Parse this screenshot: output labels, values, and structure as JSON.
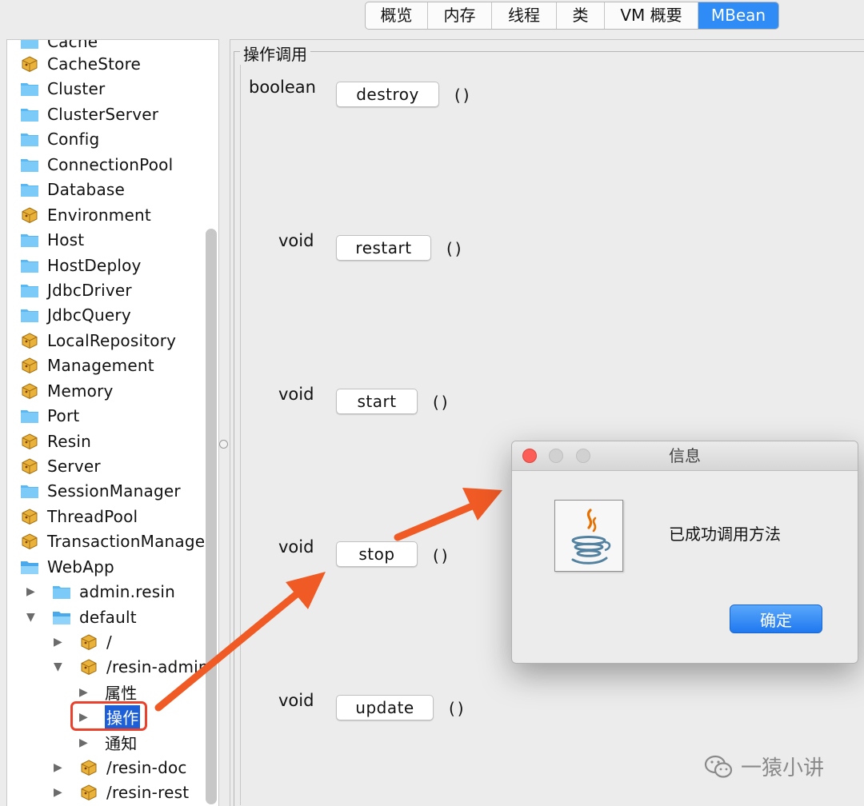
{
  "tabs": [
    {
      "label": "概览",
      "active": false
    },
    {
      "label": "内存",
      "active": false
    },
    {
      "label": "线程",
      "active": false
    },
    {
      "label": "类",
      "active": false
    },
    {
      "label": "VM 概要",
      "active": false
    },
    {
      "label": "MBean",
      "active": true
    }
  ],
  "tree": {
    "items": [
      {
        "label": "Cache",
        "icon": "folder-icon"
      },
      {
        "label": "CacheStore",
        "icon": "bean-icon"
      },
      {
        "label": "Cluster",
        "icon": "folder-icon"
      },
      {
        "label": "ClusterServer",
        "icon": "folder-icon"
      },
      {
        "label": "Config",
        "icon": "folder-icon"
      },
      {
        "label": "ConnectionPool",
        "icon": "folder-icon"
      },
      {
        "label": "Database",
        "icon": "folder-icon"
      },
      {
        "label": "Environment",
        "icon": "bean-icon"
      },
      {
        "label": "Host",
        "icon": "folder-icon"
      },
      {
        "label": "HostDeploy",
        "icon": "folder-icon"
      },
      {
        "label": "JdbcDriver",
        "icon": "folder-icon"
      },
      {
        "label": "JdbcQuery",
        "icon": "folder-icon"
      },
      {
        "label": "LocalRepository",
        "icon": "bean-icon"
      },
      {
        "label": "Management",
        "icon": "bean-icon"
      },
      {
        "label": "Memory",
        "icon": "bean-icon"
      },
      {
        "label": "Port",
        "icon": "folder-icon"
      },
      {
        "label": "Resin",
        "icon": "bean-icon"
      },
      {
        "label": "Server",
        "icon": "bean-icon"
      },
      {
        "label": "SessionManager",
        "icon": "folder-icon"
      },
      {
        "label": "ThreadPool",
        "icon": "bean-icon"
      },
      {
        "label": "TransactionManager",
        "icon": "bean-icon"
      },
      {
        "label": "WebApp",
        "icon": "open-folder-icon"
      },
      {
        "label": "admin.resin",
        "icon": "folder-icon"
      },
      {
        "label": "default",
        "icon": "open-folder-icon"
      },
      {
        "label": "/",
        "icon": "bean-icon"
      },
      {
        "label": "/resin-admin",
        "icon": "bean-icon"
      },
      {
        "label": "属性",
        "icon": ""
      },
      {
        "label": "操作",
        "icon": ""
      },
      {
        "label": "通知",
        "icon": ""
      },
      {
        "label": "/resin-doc",
        "icon": "bean-icon"
      },
      {
        "label": "/resin-rest",
        "icon": "bean-icon"
      }
    ]
  },
  "operations": {
    "group_title": "操作调用",
    "items": [
      {
        "return_type": "boolean",
        "name": "destroy",
        "params": "()"
      },
      {
        "return_type": "void",
        "name": "restart",
        "params": "()"
      },
      {
        "return_type": "void",
        "name": "start",
        "params": "()"
      },
      {
        "return_type": "void",
        "name": "stop",
        "params": "()"
      },
      {
        "return_type": "void",
        "name": "update",
        "params": "()"
      }
    ]
  },
  "dialog": {
    "title": "信息",
    "message": "已成功调用方法",
    "ok_label": "确定",
    "icon": "java-icon"
  },
  "watermark": {
    "text": "一猿小讲",
    "icon": "wechat-icon"
  },
  "colors": {
    "accent": "#2f8cf6",
    "selection": "#1d5fd6",
    "annotation": "#e9412b"
  }
}
